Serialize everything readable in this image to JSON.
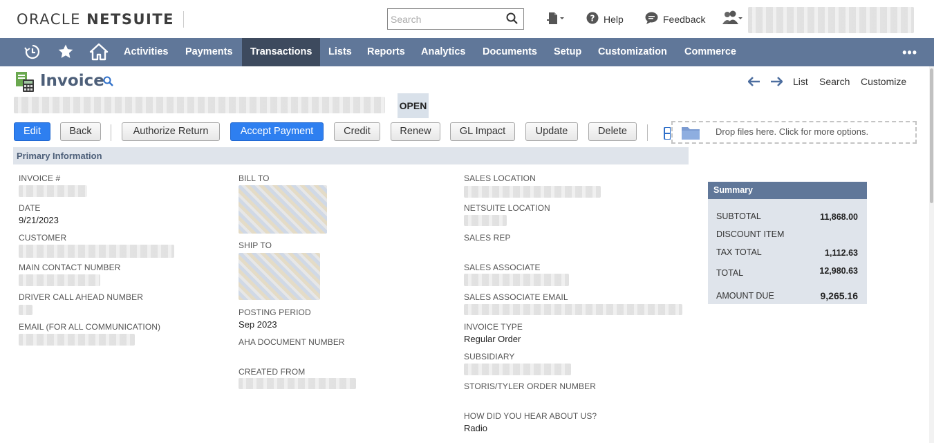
{
  "header": {
    "logo_oracle": "ORACLE",
    "logo_netsuite": "NETSUITE",
    "search_placeholder": "Search",
    "help": "Help",
    "feedback": "Feedback"
  },
  "nav": {
    "items": [
      "Activities",
      "Payments",
      "Transactions",
      "Lists",
      "Reports",
      "Analytics",
      "Documents",
      "Setup",
      "Customization",
      "Commerce"
    ],
    "active": "Transactions",
    "more": "•••"
  },
  "page": {
    "title": "Invoice",
    "status": "OPEN",
    "links": {
      "list": "List",
      "search": "Search",
      "customize": "Customize"
    }
  },
  "buttons": {
    "edit": "Edit",
    "back": "Back",
    "authorize_return": "Authorize Return",
    "accept_payment": "Accept Payment",
    "credit": "Credit",
    "renew": "Renew",
    "gl_impact": "GL Impact",
    "update": "Update",
    "delete": "Delete"
  },
  "dropzone": "Drop files here. Click for more options.",
  "section": "Primary Information",
  "fields": {
    "invoice_no": "INVOICE #",
    "date": "DATE",
    "date_value": "9/21/2023",
    "customer": "CUSTOMER",
    "main_contact": "MAIN CONTACT NUMBER",
    "driver_call": "DRIVER CALL AHEAD NUMBER",
    "email": "EMAIL (FOR ALL COMMUNICATION)",
    "bill_to": "BILL TO",
    "ship_to": "SHIP TO",
    "posting_period": "POSTING PERIOD",
    "posting_period_value": "Sep 2023",
    "aha_doc": "AHA DOCUMENT NUMBER",
    "created_from": "CREATED FROM",
    "sales_location": "SALES LOCATION",
    "netsuite_location": "NETSUITE LOCATION",
    "sales_rep": "SALES REP",
    "sales_associate": "SALES ASSOCIATE",
    "sales_associate_email": "SALES ASSOCIATE EMAIL",
    "invoice_type": "INVOICE TYPE",
    "invoice_type_value": "Regular Order",
    "subsidiary": "SUBSIDIARY",
    "storis": "STORIS/TYLER ORDER NUMBER",
    "how_hear": "HOW DID YOU HEAR ABOUT US?",
    "how_hear_value": "Radio"
  },
  "summary": {
    "title": "Summary",
    "subtotal_label": "SUBTOTAL",
    "subtotal": "11,868.00",
    "discount_label": "DISCOUNT ITEM",
    "tax_label": "TAX TOTAL",
    "tax": "1,112.63",
    "total_label": "TOTAL",
    "total": "12,980.63",
    "amount_due_label": "AMOUNT DUE",
    "amount_due": "9,265.16"
  },
  "colors": {
    "nav_bg": "#607799",
    "nav_active": "#3d4a5e",
    "primary_button": "#2e7ff0",
    "section_bg": "#dfe4eb",
    "title": "#4d5f79"
  }
}
